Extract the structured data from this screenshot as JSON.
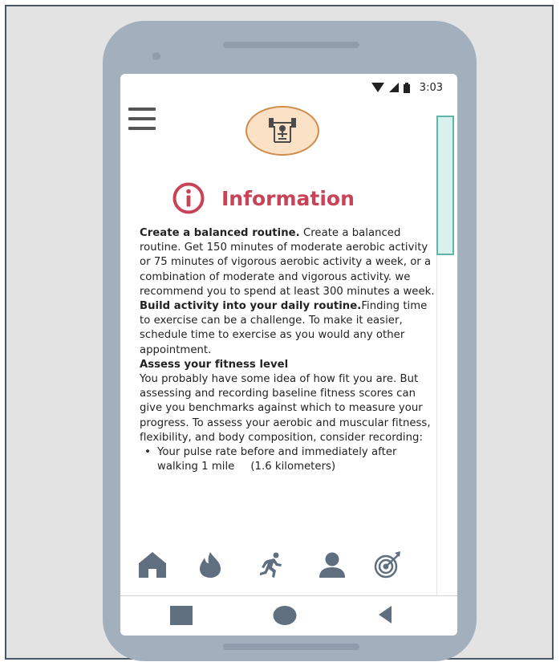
{
  "status_bar": {
    "time": "3:03",
    "icons": [
      "wifi-icon",
      "signal-icon",
      "battery-icon"
    ]
  },
  "header": {
    "menu_icon": "hamburger-menu-icon",
    "logo_icon": "weightlifter-icon"
  },
  "info": {
    "icon": "info-circle-icon",
    "title": "Information",
    "accent_color": "#c94357"
  },
  "content": {
    "sections": [
      {
        "heading": "Create a balanced routine.",
        "body": " Create a balanced routine. Get 150 minutes of moderate aerobic activity or 75 minutes of vigorous aerobic activity a week, or a combination of moderate and vigorous activity. we recommend you to spend at least 300 minutes a week."
      },
      {
        "heading": "Build activity into your daily routine.",
        "body": "Finding time to exercise can be a challenge. To make it easier, schedule time to exercise as you would any other appointment."
      },
      {
        "heading": "Assess your fitness level",
        "body": "You probably have some idea of how fit you are. But assessing and recording baseline fitness scores can give you benchmarks against which to measure your progress. To assess your aerobic and muscular fitness, flexibility, and body composition, consider recording:"
      }
    ],
    "bullets": [
      {
        "marker": "•",
        "text": "Your pulse rate before and immediately after walking 1 mile",
        "extra": "(1.6 kilometers)"
      }
    ]
  },
  "tabbar": {
    "items": [
      "home-icon",
      "flame-icon",
      "runner-icon",
      "profile-icon",
      "target-icon"
    ],
    "icon_color": "#5f6f80"
  },
  "navbar": {
    "items": [
      "recents-square-icon",
      "home-circle-icon",
      "back-triangle-icon"
    ]
  }
}
